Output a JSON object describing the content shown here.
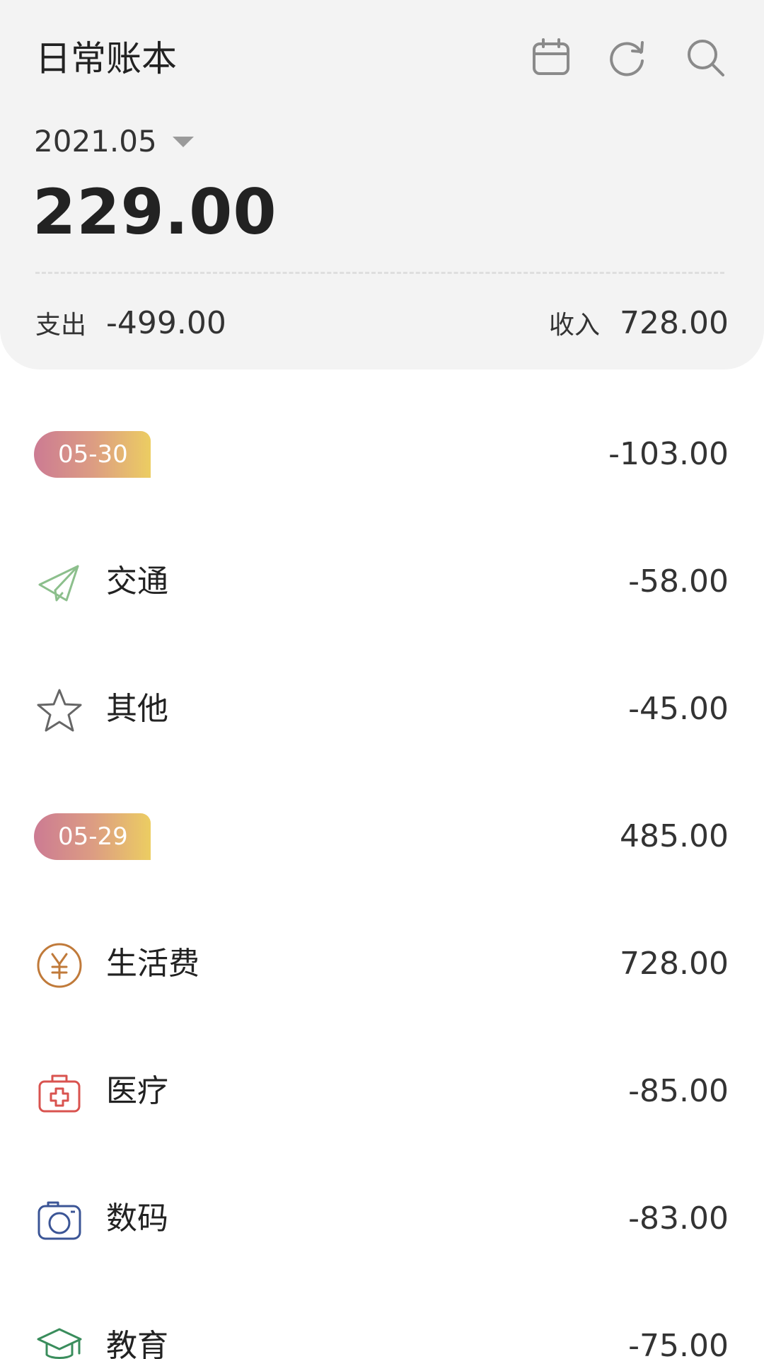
{
  "header": {
    "book_title": "日常账本",
    "icons": [
      "calendar-icon",
      "refresh-icon",
      "search-icon"
    ],
    "month": "2021.05",
    "balance": "229.00",
    "expense_label": "支出",
    "expense_value": "-499.00",
    "income_label": "收入",
    "income_value": "728.00"
  },
  "days": [
    {
      "date": "05-30",
      "total": "-103.00",
      "items": [
        {
          "category": "交通",
          "amount": "-58.00",
          "icon": "paper-plane-icon"
        },
        {
          "category": "其他",
          "amount": "-45.00",
          "icon": "star-icon"
        }
      ]
    },
    {
      "date": "05-29",
      "total": "485.00",
      "items": [
        {
          "category": "生活费",
          "amount": "728.00",
          "icon": "yuan-coin-icon"
        },
        {
          "category": "医疗",
          "amount": "-85.00",
          "icon": "medical-kit-icon"
        },
        {
          "category": "数码",
          "amount": "-83.00",
          "icon": "camera-icon"
        },
        {
          "category": "教育",
          "amount": "-75.00",
          "icon": "graduation-cap-icon"
        }
      ]
    }
  ],
  "colors": {
    "header_bg": "#f3f3f3",
    "pill_gradient_start": "#cc7b93",
    "pill_gradient_end": "#eccd62",
    "transport_icon": "#8cbf8c",
    "other_icon": "#666666",
    "living_icon": "#c07a3a",
    "medical_icon": "#d9534f",
    "digital_icon": "#3b5596",
    "education_icon": "#3a8d5c"
  }
}
